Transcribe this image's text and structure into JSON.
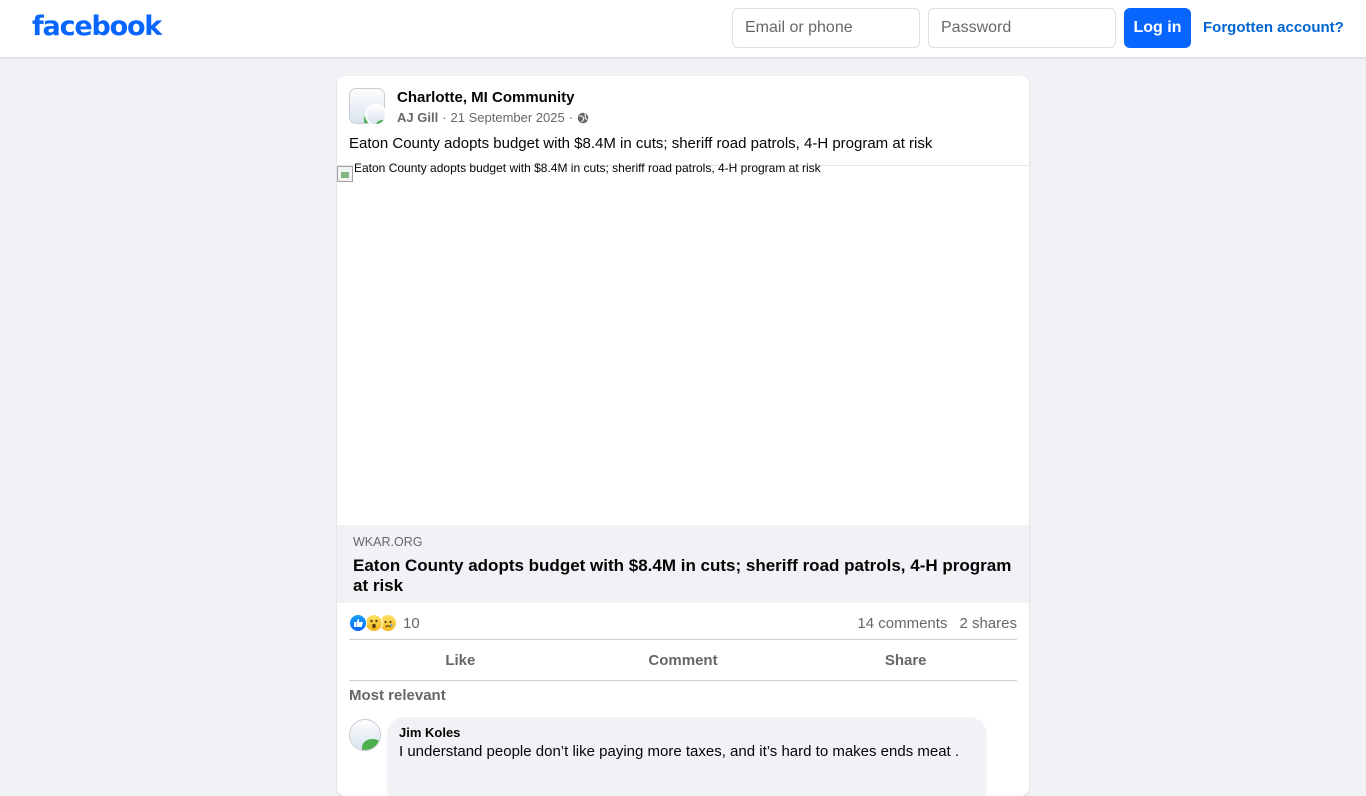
{
  "header": {
    "logo": "facebook",
    "email_placeholder": "Email or phone",
    "password_placeholder": "Password",
    "login_label": "Log in",
    "forgot_label": "Forgotten account?"
  },
  "post": {
    "group_name": "Charlotte, MI Community",
    "author": "AJ Gill",
    "date": "21 September 2025",
    "separator": "·",
    "privacy_icon": "globe-icon",
    "text": "Eaton County adopts budget with $8.4M in cuts; sheriff road patrols, 4-H program at risk",
    "image_alt": "Eaton County adopts budget with $8.4M in cuts; sheriff road patrols, 4-H program at risk",
    "link_domain": "WKAR.ORG",
    "link_title": "Eaton County adopts budget with $8.4M in cuts; sheriff road patrols, 4-H program at risk"
  },
  "stats": {
    "reactions": [
      "like-icon",
      "wow-icon",
      "sad-icon"
    ],
    "reaction_count": "10",
    "comments": "14 comments",
    "shares": "2 shares"
  },
  "actions": {
    "like": "Like",
    "comment": "Comment",
    "share": "Share"
  },
  "comments": {
    "sort_label": "Most relevant",
    "items": [
      {
        "author": "Jim Koles",
        "text": "I understand people don’t like paying more taxes, and it’s hard to makes ends meat ."
      }
    ]
  },
  "colors": {
    "brand": "#0866ff",
    "link": "#0064d1",
    "background": "#f0f2f5",
    "secondary_text": "#65676b"
  }
}
